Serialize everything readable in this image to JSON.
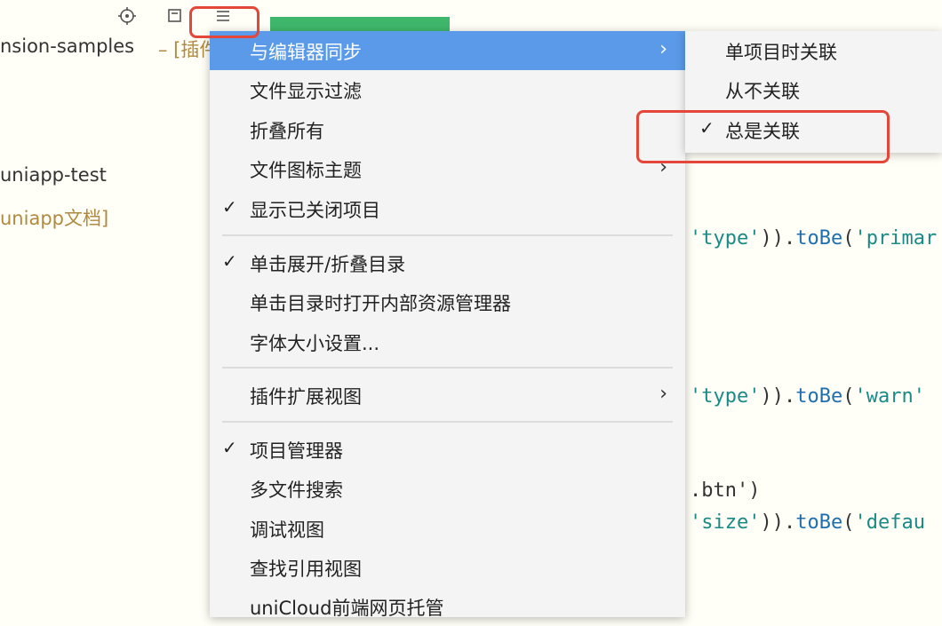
{
  "project_panel": {
    "project1_name": "nsion-samples",
    "project1_tag": "– [插件",
    "project2_name": "uniapp-test",
    "project2_tag": "uniapp文档]"
  },
  "toolbar": {
    "locate_icon": "crosshair-icon",
    "collapse_icon": "collapse-all-icon",
    "menu_icon": "hamburger-menu-icon"
  },
  "main_menu": {
    "items": [
      {
        "label": "与编辑器同步",
        "checked": false,
        "submenu": true,
        "active": true
      },
      {
        "label": "文件显示过滤",
        "checked": false,
        "submenu": false
      },
      {
        "label": "折叠所有",
        "checked": false,
        "submenu": false
      },
      {
        "label": "文件图标主题",
        "checked": false,
        "submenu": true
      },
      {
        "label": "显示已关闭项目",
        "checked": true,
        "submenu": false
      },
      {
        "label": "单击展开/折叠目录",
        "checked": true,
        "submenu": false
      },
      {
        "label": "单击目录时打开内部资源管理器",
        "checked": false,
        "submenu": false
      },
      {
        "label": "字体大小设置...",
        "checked": false,
        "submenu": false
      },
      {
        "label": "插件扩展视图",
        "checked": false,
        "submenu": true
      },
      {
        "label": "项目管理器",
        "checked": true,
        "submenu": false
      },
      {
        "label": "多文件搜索",
        "checked": false,
        "submenu": false
      },
      {
        "label": "调试视图",
        "checked": false,
        "submenu": false
      },
      {
        "label": "查找引用视图",
        "checked": false,
        "submenu": false
      },
      {
        "label": "uniCloud前端网页托管",
        "checked": false,
        "submenu": false
      }
    ],
    "check_glyph": "✓",
    "arrow_glyph": "›"
  },
  "sub_menu": {
    "items": [
      {
        "label": "单项目时关联",
        "checked": false
      },
      {
        "label": "从不关联",
        "checked": false
      },
      {
        "label": "总是关联",
        "checked": true
      }
    ]
  },
  "editor": {
    "line1": {
      "a": "'type'",
      "b": ")).",
      "c": "toBe",
      "d": "(",
      "e": "'primar"
    },
    "line2": {
      "a": "'type'",
      "b": ")).",
      "c": "toBe",
      "d": "(",
      "e": "'warn'"
    },
    "line3": {
      "a": ".btn')"
    },
    "line4": {
      "a": "'size'",
      "b": ")).",
      "c": "toBe",
      "d": "(",
      "e": "'defau"
    }
  },
  "colors": {
    "menu_highlight": "#5a9ae8",
    "annotation_red": "#e4463a",
    "tab_green": "#3fb76b",
    "string_teal": "#1a8a86",
    "method_blue": "#1f6fb0"
  }
}
